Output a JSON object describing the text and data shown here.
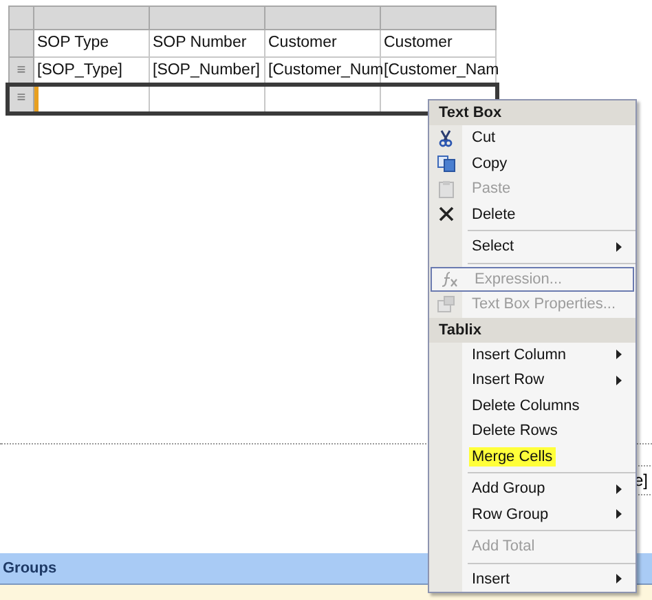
{
  "tablix": {
    "header": [
      "SOP Type",
      "SOP Number",
      "Customer",
      "Customer"
    ],
    "rows": [
      {
        "handle": "≡",
        "cells": [
          "[SOP_Type]",
          "[SOP_Number]",
          "[Customer_Num",
          "[Customer_Nam"
        ],
        "selected": false
      },
      {
        "handle": "≡",
        "cells": [],
        "selected": true
      }
    ]
  },
  "canvas_fragment": "e]",
  "groups_bar": {
    "title": "Groups"
  },
  "context_menu": {
    "items": [
      {
        "kind": "header",
        "label": "Text Box"
      },
      {
        "kind": "item",
        "label": "Cut",
        "disabled": false,
        "submenu": false,
        "highlighted": false,
        "hovered": false
      },
      {
        "kind": "item",
        "label": "Copy",
        "disabled": false,
        "submenu": false,
        "highlighted": false,
        "hovered": false
      },
      {
        "kind": "item",
        "label": "Paste",
        "disabled": true,
        "submenu": false,
        "highlighted": false,
        "hovered": false
      },
      {
        "kind": "item",
        "label": "Delete",
        "disabled": false,
        "submenu": false,
        "highlighted": false,
        "hovered": false
      },
      {
        "kind": "separator"
      },
      {
        "kind": "item",
        "label": "Select",
        "disabled": false,
        "submenu": true,
        "highlighted": false,
        "hovered": false
      },
      {
        "kind": "separator"
      },
      {
        "kind": "item",
        "label": "Expression...",
        "disabled": true,
        "submenu": false,
        "highlighted": false,
        "hovered": true
      },
      {
        "kind": "item",
        "label": "Text Box Properties...",
        "disabled": true,
        "submenu": false,
        "highlighted": false,
        "hovered": false
      },
      {
        "kind": "header",
        "label": "Tablix"
      },
      {
        "kind": "item",
        "label": "Insert Column",
        "disabled": false,
        "submenu": true,
        "highlighted": false,
        "hovered": false
      },
      {
        "kind": "item",
        "label": "Insert Row",
        "disabled": false,
        "submenu": true,
        "highlighted": false,
        "hovered": false
      },
      {
        "kind": "item",
        "label": "Delete Columns",
        "disabled": false,
        "submenu": false,
        "highlighted": false,
        "hovered": false
      },
      {
        "kind": "item",
        "label": "Delete Rows",
        "disabled": false,
        "submenu": false,
        "highlighted": false,
        "hovered": false
      },
      {
        "kind": "item",
        "label": "Merge Cells",
        "disabled": false,
        "submenu": false,
        "highlighted": true,
        "hovered": false
      },
      {
        "kind": "separator"
      },
      {
        "kind": "item",
        "label": "Add Group",
        "disabled": false,
        "submenu": true,
        "highlighted": false,
        "hovered": false
      },
      {
        "kind": "item",
        "label": "Row Group",
        "disabled": false,
        "submenu": true,
        "highlighted": false,
        "hovered": false
      },
      {
        "kind": "separator"
      },
      {
        "kind": "item",
        "label": "Add Total",
        "disabled": true,
        "submenu": false,
        "highlighted": false,
        "hovered": false
      },
      {
        "kind": "separator"
      },
      {
        "kind": "item",
        "label": "Insert",
        "disabled": false,
        "submenu": true,
        "highlighted": false,
        "hovered": false
      }
    ]
  }
}
